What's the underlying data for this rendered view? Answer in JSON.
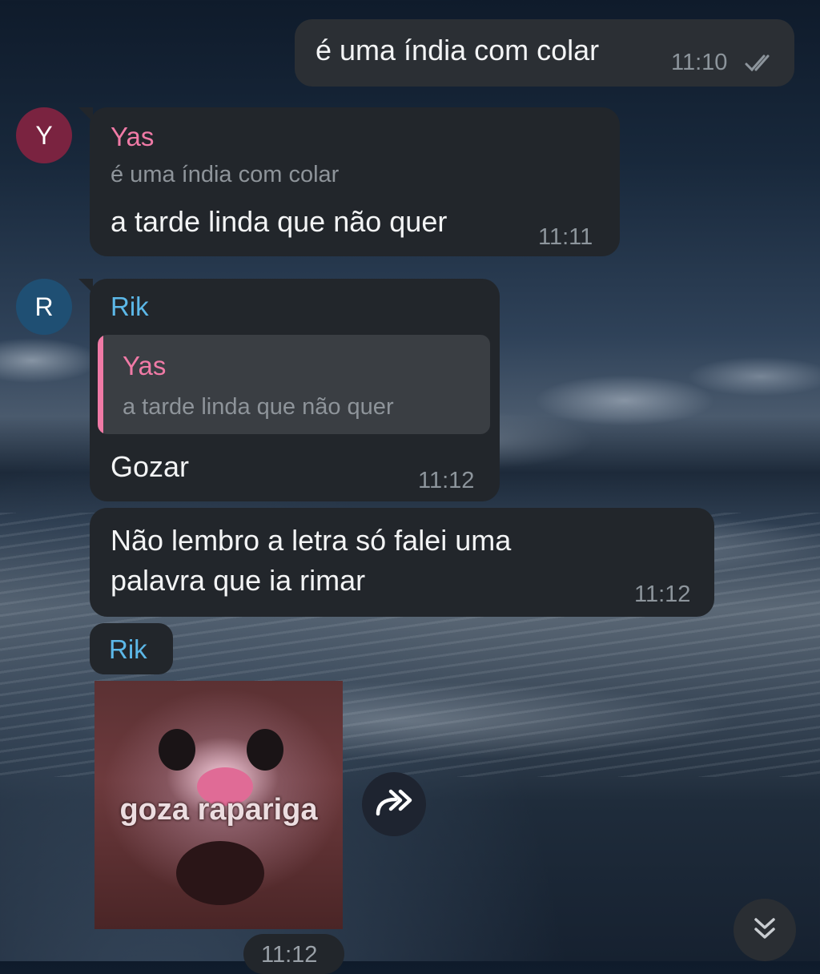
{
  "colors": {
    "yas": "#f07aa6",
    "rik": "#5cb8e8",
    "avatar_y": "#7a2340",
    "avatar_r": "#1f4f73"
  },
  "messages": [
    {
      "id": "m1",
      "direction": "outgoing",
      "text": "é uma índia com colar",
      "time": "11:10",
      "status": "read"
    },
    {
      "id": "m2",
      "direction": "incoming",
      "avatar_letter": "Y",
      "sender": "Yas",
      "quoted_text": "é uma índia com colar",
      "text": "a tarde linda que não quer",
      "time": "11:11"
    },
    {
      "id": "m3",
      "direction": "incoming",
      "avatar_letter": "R",
      "sender": "Rik",
      "reply_to_sender": "Yas",
      "reply_to_text": "a tarde linda que não quer",
      "text": "Gozar",
      "time": "11:12"
    },
    {
      "id": "m4",
      "direction": "incoming",
      "text_lines": [
        "Não lembro a letra só falei uma",
        "palavra que ia rimar"
      ],
      "time": "11:12"
    },
    {
      "id": "m5",
      "direction": "incoming",
      "sender": "Rik",
      "sticker_caption": "goza rapariga",
      "time": "11:12"
    }
  ],
  "icons": {
    "forward": "forward-arrow-icon",
    "scroll_down": "double-chevron-down-icon",
    "read_status": "double-check-icon"
  }
}
